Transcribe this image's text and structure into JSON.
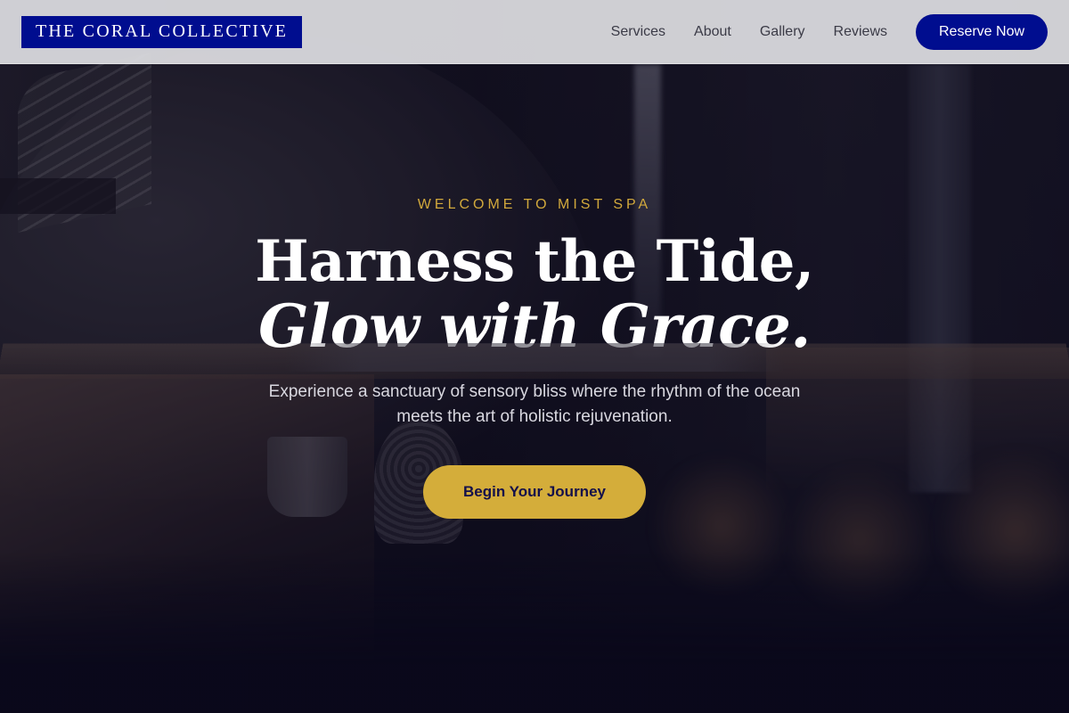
{
  "brand": {
    "logo_text": "THE CORAL COLLECTIVE"
  },
  "nav": {
    "items": [
      {
        "label": "Services"
      },
      {
        "label": "About"
      },
      {
        "label": "Gallery"
      },
      {
        "label": "Reviews"
      }
    ],
    "cta_label": "Reserve Now"
  },
  "hero": {
    "eyebrow": "WELCOME TO MIST SPA",
    "headline_line1": "Harness the Tide,",
    "headline_line2": "Glow with Grace.",
    "subtitle": "Experience a sanctuary of sensory bliss where the rhythm of the ocean meets the art of holistic rejuvenation.",
    "cta_label": "Begin Your Journey"
  },
  "colors": {
    "brand_navy": "#000d8f",
    "accent_gold": "#d4ad3a",
    "header_bg": "#dedee2",
    "hero_dark": "#0b0a1c"
  }
}
